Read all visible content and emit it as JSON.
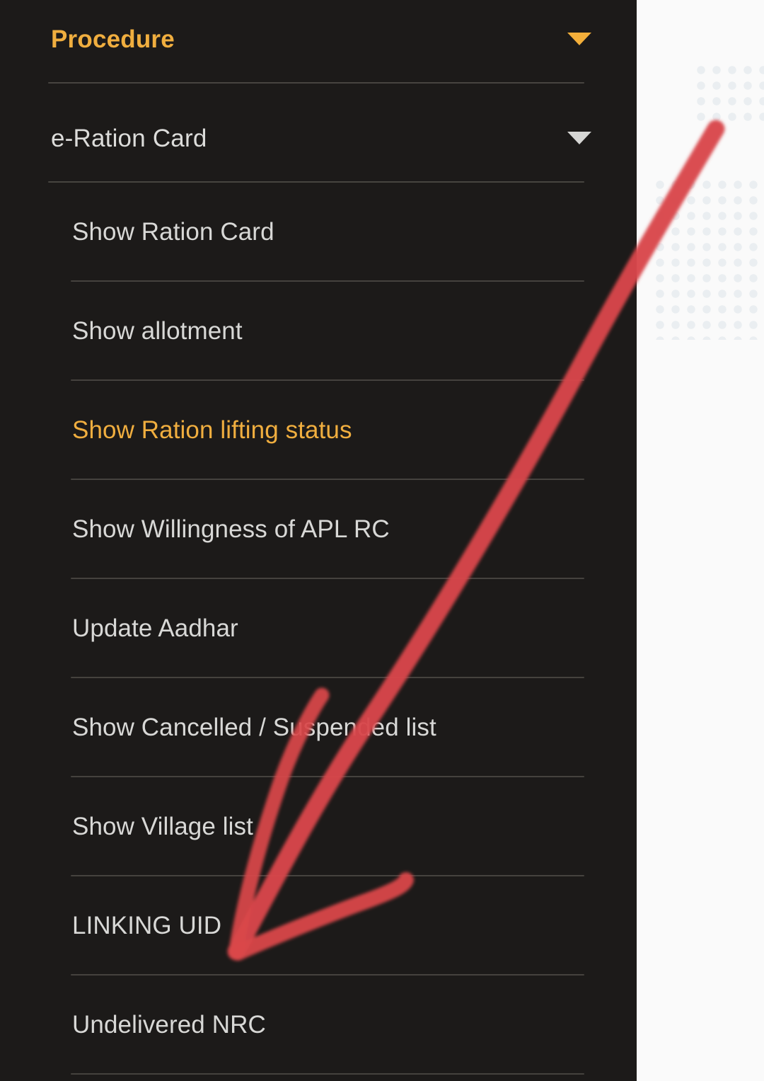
{
  "app": {
    "drawer_title": "navigation-drawer"
  },
  "colors": {
    "drawer_background": "#1C1A19",
    "page_background": "#FAFAFA",
    "accent": "#F0AE3F",
    "item_text": "#D8D8D6",
    "divider": "#45423E",
    "annotation": "#DB4B4B",
    "dot_pattern": "#DDE4E9"
  },
  "sections": [
    {
      "label": "Procedure",
      "state": "expanded",
      "highlighted": true,
      "caret_icon": "chevron-down-icon"
    },
    {
      "label": "e-Ration Card",
      "state": "expanded",
      "highlighted": false,
      "caret_icon": "chevron-down-icon"
    }
  ],
  "items": [
    {
      "label": "Show Ration Card",
      "highlighted": false
    },
    {
      "label": "Show allotment",
      "highlighted": false
    },
    {
      "label": "Show Ration lifting status",
      "highlighted": true
    },
    {
      "label": "Show Willingness of APL RC",
      "highlighted": false
    },
    {
      "label": "Update Aadhar",
      "highlighted": false
    },
    {
      "label": "Show Cancelled / Suspended list",
      "highlighted": false
    },
    {
      "label": "Show Village list",
      "highlighted": false
    },
    {
      "label": "LINKING UID",
      "highlighted": false
    },
    {
      "label": "Undelivered NRC",
      "highlighted": false
    }
  ],
  "annotation": {
    "type": "hand-drawn-arrow",
    "color": "#DB4B4B",
    "points_to": "LINKING UID",
    "description": "red marker arrow drawn from upper-right down to the LINKING UID menu entry"
  }
}
